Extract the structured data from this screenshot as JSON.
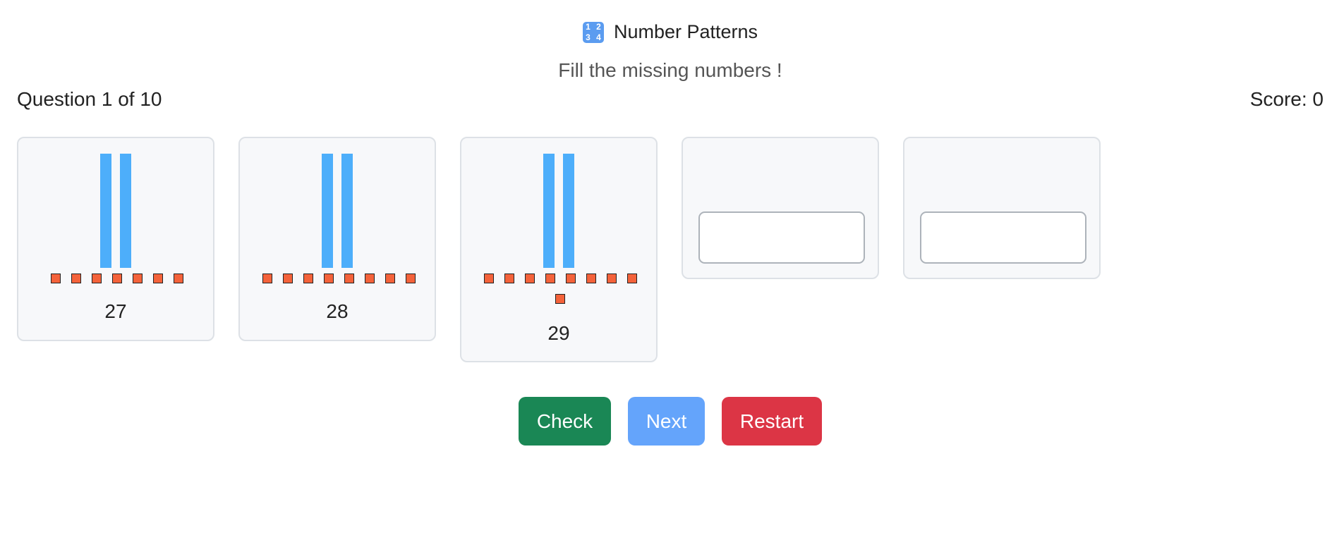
{
  "header": {
    "icon_glyphs": [
      "1",
      "2",
      "3",
      "4"
    ],
    "title": "Number Patterns",
    "subtitle": "Fill the missing numbers !"
  },
  "status": {
    "question": "Question 1 of 10",
    "score": "Score: 0"
  },
  "cards": [
    {
      "tens": 2,
      "ones": 7,
      "number": "27"
    },
    {
      "tens": 2,
      "ones": 8,
      "number": "28"
    },
    {
      "tens": 2,
      "ones": 9,
      "number": "29"
    }
  ],
  "inputs": [
    {
      "value": "",
      "placeholder": ""
    },
    {
      "value": "",
      "placeholder": ""
    }
  ],
  "buttons": {
    "check": "Check",
    "next": "Next",
    "restart": "Restart"
  },
  "colors": {
    "rod": "#4daefa",
    "unit": "#f4623a",
    "check": "#1a8755",
    "next": "#64a4fb",
    "restart": "#dc3545"
  }
}
